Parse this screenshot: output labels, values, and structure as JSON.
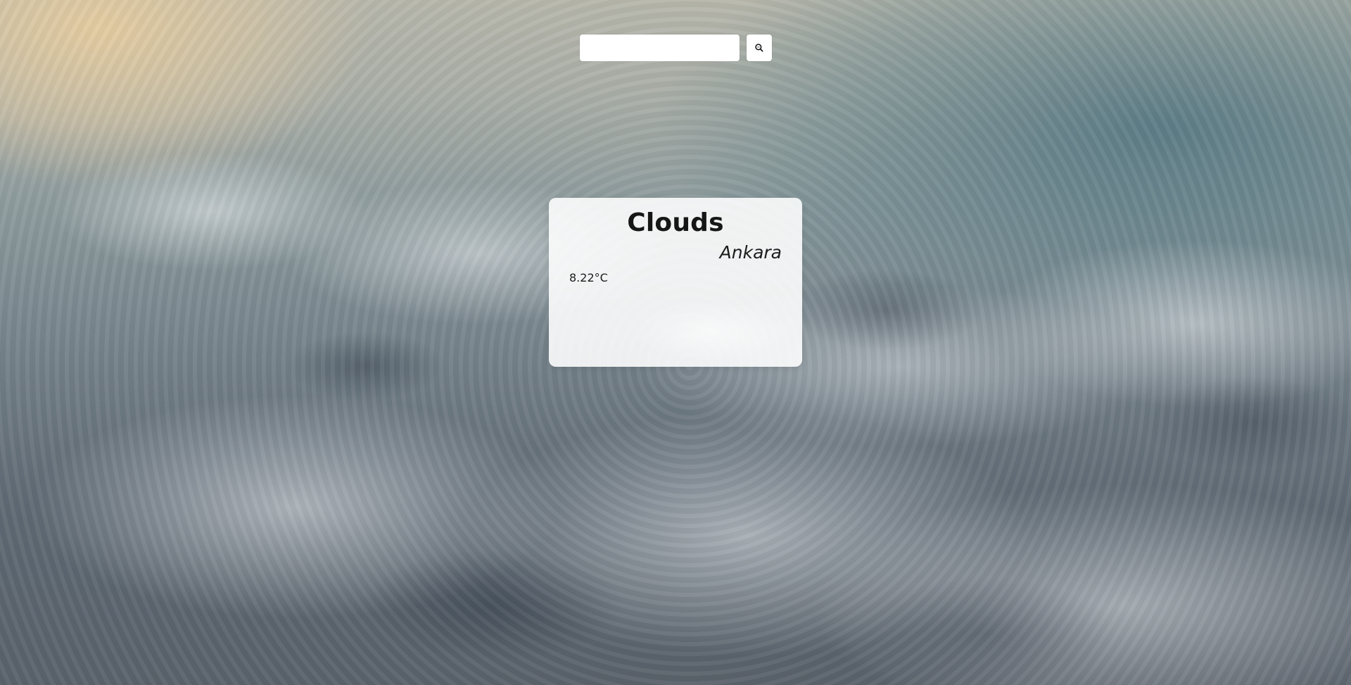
{
  "search": {
    "value": "",
    "placeholder": ""
  },
  "icons": {
    "search_button_icon": "search-icon"
  },
  "weather": {
    "condition": "Clouds",
    "city": "Ankara",
    "temperature": "8.22°C"
  }
}
